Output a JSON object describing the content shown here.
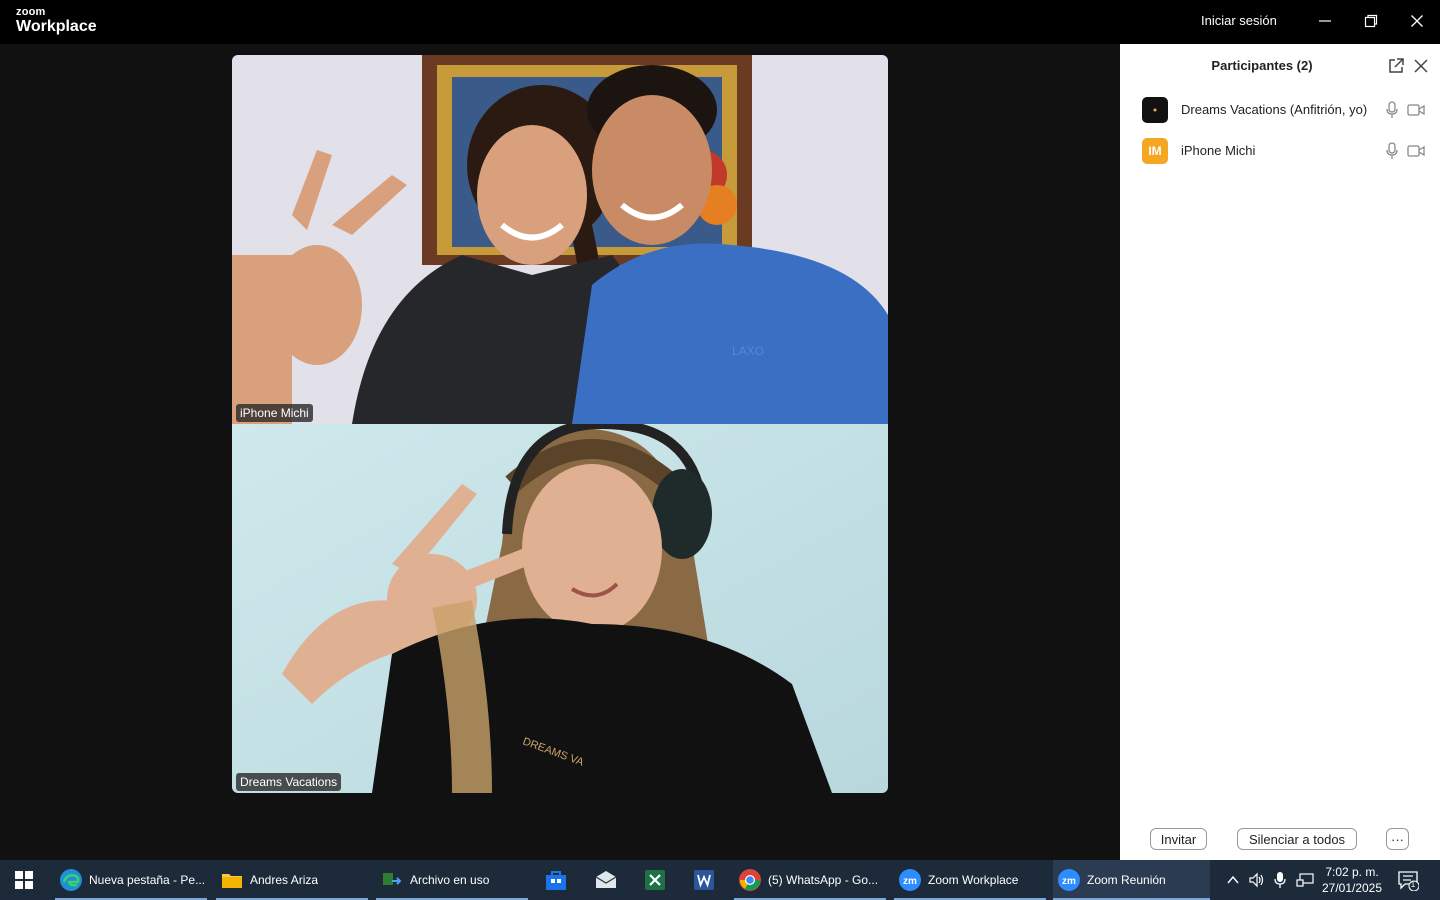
{
  "titlebar": {
    "logo_top": "zoom",
    "logo_bottom": "Workplace",
    "signin": "Iniciar sesión",
    "icons": [
      "minimize-icon",
      "restore-icon",
      "close-icon"
    ]
  },
  "videos": [
    {
      "label": "iPhone Michi"
    },
    {
      "label": "Dreams Vacations"
    }
  ],
  "panel": {
    "title": "Participantes (2)",
    "participants": [
      {
        "name": "Dreams Vacations (Anfitrión, yo)",
        "avatar_text": "",
        "avatar_color": "#111111"
      },
      {
        "name": "iPhone Michi",
        "avatar_text": "IM",
        "avatar_color": "#F5A623"
      }
    ],
    "invite": "Invitar",
    "mute_all": "Silenciar a todos",
    "more": "···"
  },
  "taskbar": {
    "items": [
      {
        "label": "Nueva pestaña - Pe...",
        "icon": "edge-icon"
      },
      {
        "label": "Andres Ariza",
        "icon": "folder-icon"
      },
      {
        "label": "Archivo en uso",
        "icon": "file-move-icon"
      },
      {
        "label": "(5) WhatsApp - Go...",
        "icon": "chrome-icon"
      },
      {
        "label": "Zoom Workplace",
        "icon": "zoom-icon"
      },
      {
        "label": "Zoom Reunión",
        "icon": "zoom-icon"
      }
    ],
    "pinned": [
      "store-icon",
      "mail-icon",
      "excel-icon",
      "word-icon"
    ],
    "time": "7:02 p. m.",
    "date": "27/01/2025",
    "notification_count": "1"
  }
}
